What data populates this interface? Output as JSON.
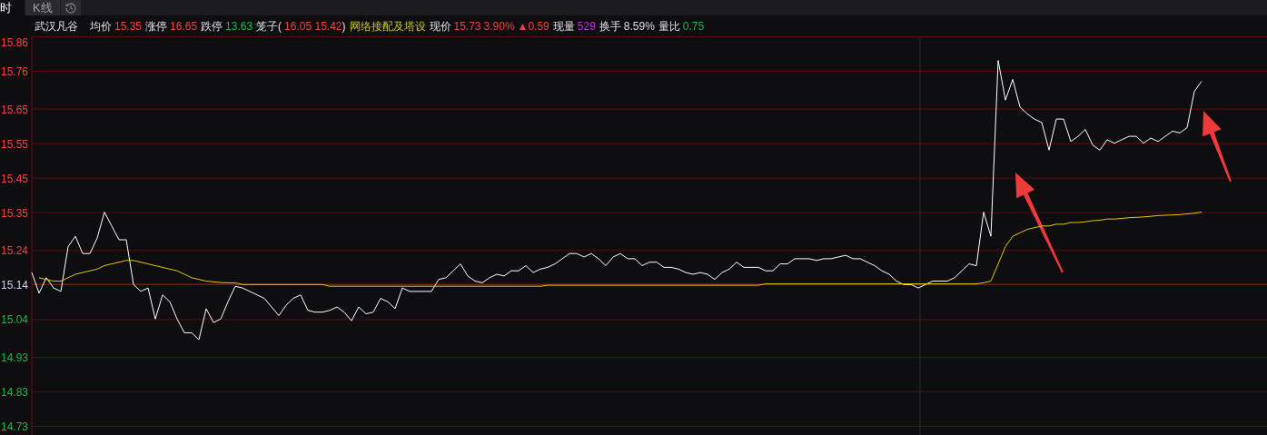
{
  "tabs": [
    {
      "label": "时",
      "kind": "text",
      "selected": true
    },
    {
      "label": "K线",
      "kind": "text",
      "selected": false
    },
    {
      "kind": "icon",
      "selected": false
    }
  ],
  "info": {
    "stock_name": "武汉凡谷",
    "fields": [
      {
        "kind": "pair",
        "label": "均价",
        "values": [
          {
            "text": "15.35",
            "color": "#f04040"
          }
        ]
      },
      {
        "kind": "pair",
        "label": "涨停",
        "values": [
          {
            "text": "16.65",
            "color": "#f04040"
          }
        ]
      },
      {
        "kind": "pair",
        "label": "跌停",
        "values": [
          {
            "text": "13.63",
            "color": "#14b84a"
          }
        ]
      },
      {
        "kind": "pair",
        "label": "笼子(",
        "values": [
          {
            "text": "16.05 15.42",
            "color": "#f04040"
          }
        ],
        "suffix": ")"
      },
      {
        "kind": "tag",
        "label": "网络接配及塔设"
      },
      {
        "kind": "pair",
        "label": "现价",
        "values": [
          {
            "text": "15.73",
            "color": "#f04040"
          },
          {
            "text": "3.90%",
            "color": "#f04040"
          },
          {
            "text": "▲0.59",
            "color": "#f04040"
          }
        ]
      },
      {
        "kind": "pair",
        "label": "现量",
        "values": [
          {
            "text": "529",
            "color": "#c22ee0"
          }
        ]
      },
      {
        "kind": "pair",
        "label": "换手",
        "values": [
          {
            "text": "8.59%",
            "color": "#dcdcdc"
          }
        ]
      },
      {
        "kind": "pair",
        "label": "量比",
        "values": [
          {
            "text": "0.75",
            "color": "#14b84a"
          }
        ]
      }
    ]
  },
  "chart_data": {
    "type": "line",
    "grid": true,
    "ylim": [
      14.73,
      15.86
    ],
    "yticks": [
      {
        "value": 15.86,
        "label": "15.86"
      },
      {
        "value": 15.76,
        "label": "15.76"
      },
      {
        "value": 15.65,
        "label": "15.65"
      },
      {
        "value": 15.55,
        "label": "15.55"
      },
      {
        "value": 15.45,
        "label": "15.45"
      },
      {
        "value": 15.35,
        "label": "15.35"
      },
      {
        "value": 15.24,
        "label": "15.24"
      },
      {
        "value": 15.14,
        "label": "15.14"
      },
      {
        "value": 15.04,
        "label": "15.04"
      },
      {
        "value": 14.93,
        "label": "14.93"
      },
      {
        "value": 14.83,
        "label": "14.83"
      },
      {
        "value": 14.73,
        "label": "14.73"
      }
    ],
    "series": [
      {
        "color": "#8c1010",
        "values": [
          15.14,
          15.14,
          15.14,
          15.14,
          15.14,
          15.14,
          15.14,
          15.14,
          15.14,
          15.14,
          15.14,
          15.14,
          15.14,
          15.14,
          15.14,
          15.14,
          15.14,
          15.14,
          15.14,
          15.14,
          15.14,
          15.14,
          15.14,
          15.14,
          15.14,
          15.14,
          15.14,
          15.14,
          15.14,
          15.14,
          15.14,
          15.14,
          15.14,
          15.14,
          15.14,
          15.14,
          15.14,
          15.14,
          15.14,
          15.14,
          15.14,
          15.14,
          15.14,
          15.14,
          15.14,
          15.14,
          15.14,
          15.14,
          15.14,
          15.14,
          15.14,
          15.14,
          15.14,
          15.14,
          15.14,
          15.14,
          15.14,
          15.14,
          15.14,
          15.14,
          15.14,
          15.14,
          15.14,
          15.14,
          15.14,
          15.14,
          15.14,
          15.14,
          15.14,
          15.14,
          15.14,
          15.14,
          15.14,
          15.14,
          15.14,
          15.14,
          15.14,
          15.14,
          15.14,
          15.14,
          15.14,
          15.14,
          15.14,
          15.14,
          15.14,
          15.14,
          15.14,
          15.14,
          15.14,
          15.14,
          15.14,
          15.14,
          15.14,
          15.14,
          15.14,
          15.14,
          15.14,
          15.14,
          15.14,
          15.14,
          15.14,
          15.14,
          15.14,
          15.14,
          15.14,
          15.14,
          15.14,
          15.14,
          15.14,
          15.14,
          15.14,
          15.14,
          15.14,
          15.14,
          15.14,
          15.14,
          15.14,
          15.14,
          15.14,
          15.14,
          15.14,
          15.14,
          15.14,
          15.14,
          15.14,
          15.14,
          15.14,
          15.14,
          15.14,
          15.14,
          15.14,
          15.14,
          15.14,
          15.14,
          15.14,
          15.14,
          15.14,
          15.14,
          15.14,
          15.14,
          15.14,
          15.14,
          15.14,
          15.14,
          15.14,
          15.14,
          15.14,
          15.14,
          15.14,
          15.14,
          15.14,
          15.14,
          15.14,
          15.14,
          15.14,
          15.14,
          15.14,
          15.14,
          15.14,
          15.14,
          15.14,
          15.14,
          15.14,
          15.14,
          15.14,
          15.14,
          15.14,
          15.14,
          15.14,
          15.14,
          15.14
        ]
      },
      {
        "color": "#ffffff",
        "values": [
          15.175,
          15.115,
          15.16,
          15.13,
          15.12,
          15.25,
          15.28,
          15.23,
          15.23,
          15.275,
          15.35,
          15.31,
          15.27,
          15.27,
          15.14,
          15.12,
          15.13,
          15.04,
          15.11,
          15.09,
          15.04,
          15.0,
          15.0,
          14.98,
          15.07,
          15.03,
          15.04,
          15.09,
          15.135,
          15.13,
          15.12,
          15.11,
          15.1,
          15.075,
          15.05,
          15.08,
          15.1,
          15.11,
          15.065,
          15.06,
          15.06,
          15.065,
          15.075,
          15.06,
          15.035,
          15.075,
          15.055,
          15.06,
          15.1,
          15.09,
          15.07,
          15.13,
          15.12,
          15.12,
          15.12,
          15.12,
          15.155,
          15.16,
          15.18,
          15.2,
          15.165,
          15.15,
          15.145,
          15.16,
          15.17,
          15.165,
          15.18,
          15.18,
          15.195,
          15.175,
          15.185,
          15.19,
          15.2,
          15.215,
          15.23,
          15.23,
          15.22,
          15.23,
          15.215,
          15.195,
          15.22,
          15.23,
          15.215,
          15.215,
          15.195,
          15.205,
          15.205,
          15.19,
          15.19,
          15.185,
          15.175,
          15.17,
          15.175,
          15.17,
          15.155,
          15.175,
          15.185,
          15.205,
          15.19,
          15.19,
          15.19,
          15.18,
          15.18,
          15.2,
          15.2,
          15.215,
          15.215,
          15.215,
          15.21,
          15.215,
          15.215,
          15.22,
          15.225,
          15.215,
          15.215,
          15.205,
          15.195,
          15.18,
          15.17,
          15.15,
          15.14,
          15.14,
          15.13,
          15.14,
          15.15,
          15.15,
          15.15,
          15.16,
          15.18,
          15.2,
          15.195,
          15.35,
          15.28,
          15.79,
          15.675,
          15.735,
          15.655,
          15.635,
          15.62,
          15.61,
          15.53,
          15.62,
          15.62,
          15.555,
          15.57,
          15.59,
          15.545,
          15.53,
          15.56,
          15.55,
          15.56,
          15.57,
          15.57,
          15.55,
          15.565,
          15.555,
          15.57,
          15.585,
          15.58,
          15.595,
          15.7,
          15.73
        ]
      },
      {
        "color": "#e6c800",
        "values": [
          null,
          15.16,
          15.155,
          15.15,
          15.15,
          15.16,
          15.17,
          15.175,
          15.18,
          15.185,
          15.195,
          15.2,
          15.205,
          15.21,
          15.21,
          15.205,
          15.2,
          15.195,
          15.19,
          15.185,
          15.18,
          15.17,
          15.16,
          15.155,
          15.15,
          15.148,
          15.146,
          15.145,
          15.145,
          15.14,
          15.14,
          15.14,
          15.14,
          15.14,
          15.14,
          15.14,
          15.14,
          15.14,
          15.14,
          15.14,
          15.14,
          15.135,
          15.135,
          15.135,
          15.135,
          15.135,
          15.135,
          15.135,
          15.135,
          15.135,
          15.135,
          15.135,
          15.135,
          15.135,
          15.135,
          15.135,
          15.135,
          15.135,
          15.135,
          15.135,
          15.135,
          15.135,
          15.135,
          15.135,
          15.135,
          15.135,
          15.135,
          15.135,
          15.135,
          15.135,
          15.135,
          15.138,
          15.138,
          15.138,
          15.138,
          15.138,
          15.138,
          15.138,
          15.138,
          15.138,
          15.138,
          15.138,
          15.138,
          15.138,
          15.138,
          15.138,
          15.138,
          15.138,
          15.138,
          15.138,
          15.138,
          15.138,
          15.138,
          15.138,
          15.138,
          15.138,
          15.138,
          15.138,
          15.138,
          15.138,
          15.138,
          15.142,
          15.142,
          15.142,
          15.142,
          15.142,
          15.142,
          15.142,
          15.142,
          15.142,
          15.142,
          15.142,
          15.142,
          15.142,
          15.142,
          15.142,
          15.142,
          15.142,
          15.142,
          15.142,
          15.142,
          15.142,
          15.142,
          15.142,
          15.142,
          15.142,
          15.142,
          15.142,
          15.142,
          15.142,
          15.142,
          15.145,
          15.15,
          15.2,
          15.25,
          15.28,
          15.29,
          15.3,
          15.305,
          15.31,
          15.31,
          15.315,
          15.315,
          15.32,
          15.32,
          15.322,
          15.325,
          15.327,
          15.33,
          15.33,
          15.332,
          15.334,
          15.335,
          15.336,
          15.338,
          15.34,
          15.341,
          15.342,
          15.343,
          15.345,
          15.347,
          15.35
        ]
      }
    ]
  }
}
